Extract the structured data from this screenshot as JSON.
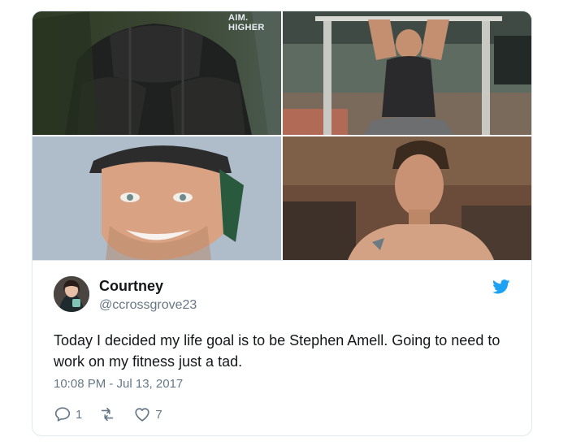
{
  "media": {
    "watermark_text": "AIM. HIGHER",
    "info_icon": "info-icon",
    "photos": [
      {
        "name": "photo-arrow-costume"
      },
      {
        "name": "photo-pullup-workout"
      },
      {
        "name": "photo-smiling-closeup"
      },
      {
        "name": "photo-shirtless-portrait"
      }
    ]
  },
  "author": {
    "display_name": "Courtney",
    "handle": "@ccrossgrove23",
    "avatar_icon": "avatar"
  },
  "tweet": {
    "text": "Today I decided my life goal is to be Stephen Amell. Going to need to work on my fitness just a tad.",
    "timestamp": "10:08 PM - Jul 13, 2017"
  },
  "actions": {
    "reply_count": "1",
    "retweet_count": "",
    "like_count": "7"
  },
  "colors": {
    "text_primary": "#14171a",
    "text_secondary": "#657786",
    "twitter_blue": "#1da1f2",
    "border": "#e1e8ed"
  }
}
